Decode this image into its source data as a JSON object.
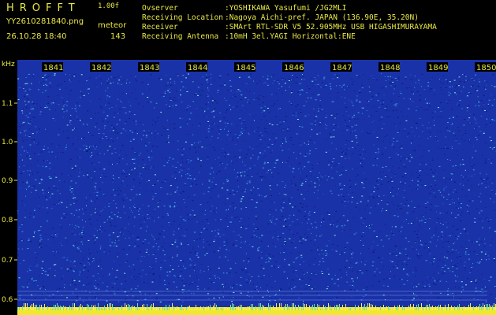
{
  "header": {
    "app_title": "HROFFT",
    "app_version": "1.00f",
    "file_name": "YY2610281840.png",
    "datetime": "26.10.28 18:40",
    "meteor_label": "meteor",
    "meteor_count": "143",
    "info": [
      {
        "key": "Ovserver",
        "value": ":YOSHIKAWA Yasufumi /JG2MLI"
      },
      {
        "key": "Receiving Location",
        "value": ":Nagoya Aichi-pref. JAPAN (136.90E, 35.20N)"
      },
      {
        "key": "Receiver",
        "value": ":SMArt RTL-SDR V5 52.905MHz USB HIGASHIMURAYAMA"
      },
      {
        "key": "Receiving Antenna",
        "value": ":10mH 3el.YAGI Horizontal:ENE"
      }
    ]
  },
  "axis": {
    "y_unit": "kHz",
    "y_ticks": [
      "1.1",
      "1.0",
      "0.9",
      "0.8",
      "0.7",
      "0.6"
    ],
    "time_ticks": [
      "1841",
      "1842",
      "1843",
      "1844",
      "1845",
      "1846",
      "1847",
      "1848",
      "1849",
      "1850"
    ]
  },
  "colors": {
    "text": "#e8e845",
    "background": "#000000",
    "spectrogram_base": "#1a32a8",
    "noise_low": "#0a1a7a",
    "noise_mid": "#3aa0e8",
    "noise_high": "#7df0e0",
    "bottom_band": "#f0e830"
  }
}
